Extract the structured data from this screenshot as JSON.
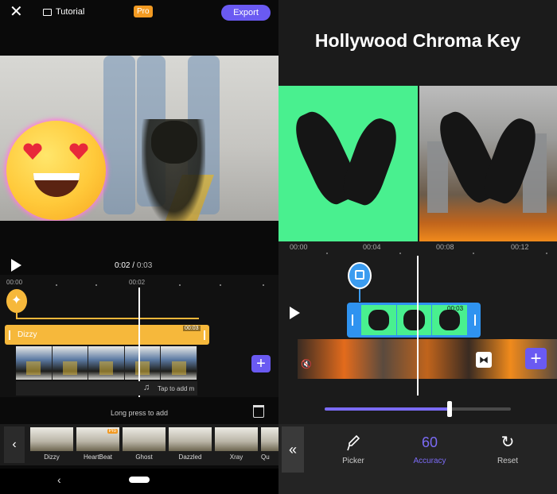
{
  "left": {
    "topbar": {
      "close_icon": "close-icon",
      "tutorial_label": "Tutorial",
      "pro_badge": "Pro",
      "export_label": "Export"
    },
    "player": {
      "current_time": "0:02",
      "separator": "/",
      "total_time": "0:03"
    },
    "timeline": {
      "ruler": [
        "00:00",
        "00:02"
      ],
      "sticker_clip_label": "Dizzy",
      "sticker_clip_duration": "00:03",
      "audio_hint": "Tap to add m"
    },
    "hint": "Long press to add",
    "effects": [
      {
        "label": "Dizzy",
        "pro": false
      },
      {
        "label": "HeartBeat",
        "pro": true
      },
      {
        "label": "Ghost",
        "pro": false
      },
      {
        "label": "Dazzled",
        "pro": false
      },
      {
        "label": "Xray",
        "pro": false
      },
      {
        "label": "Qu",
        "pro": false
      }
    ],
    "effect_pro_label": "Pro",
    "colors": {
      "accent": "#6a5af2",
      "sticker": "#f6b83b",
      "pro": "#f29a22"
    }
  },
  "right": {
    "title": "Hollywood Chroma Key",
    "ruler": [
      "00:00",
      "00:04",
      "00:08",
      "00:12"
    ],
    "clip_duration": "00:03",
    "accuracy_fraction": 0.67,
    "tools": [
      {
        "label": "Picker",
        "icon": "eyedropper-icon",
        "active": false
      },
      {
        "label": "Accuracy",
        "value": "60",
        "active": true
      },
      {
        "label": "Reset",
        "icon": "reset-icon",
        "active": false
      }
    ],
    "colors": {
      "chroma_green": "#49f08f",
      "selected_clip": "#2f93f0",
      "accent": "#7b6bf5"
    }
  }
}
